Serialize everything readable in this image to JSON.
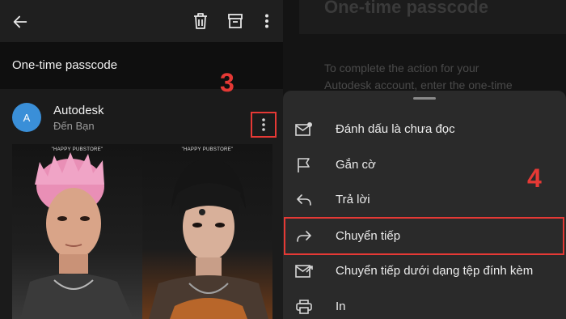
{
  "left": {
    "subject": "One-time passcode",
    "sender": {
      "avatar_letter": "A",
      "name": "Autodesk",
      "to": "Đến Bạn"
    },
    "step_label": "3",
    "posters": [
      {
        "title": "\"HAPPY PUBSTORE\""
      },
      {
        "title": "\"HAPPY PUBSTORE\""
      }
    ]
  },
  "right": {
    "email_heading": "One-time passcode",
    "email_body": "To complete the action for your Autodesk account, enter the one-time",
    "step_label": "4",
    "menu": [
      {
        "label": "Đánh dấu là chưa đọc",
        "icon": "mark-unread-icon"
      },
      {
        "label": "Gắn cờ",
        "icon": "flag-icon"
      },
      {
        "label": "Trả lời",
        "icon": "reply-icon"
      },
      {
        "label": "Chuyển tiếp",
        "icon": "forward-icon"
      },
      {
        "label": "Chuyển tiếp dưới dạng tệp đính kèm",
        "icon": "forward-attachment-icon"
      },
      {
        "label": "In",
        "icon": "print-icon"
      }
    ]
  },
  "colors": {
    "accent_red": "#e53935",
    "avatar_blue": "#3a8fd8"
  }
}
